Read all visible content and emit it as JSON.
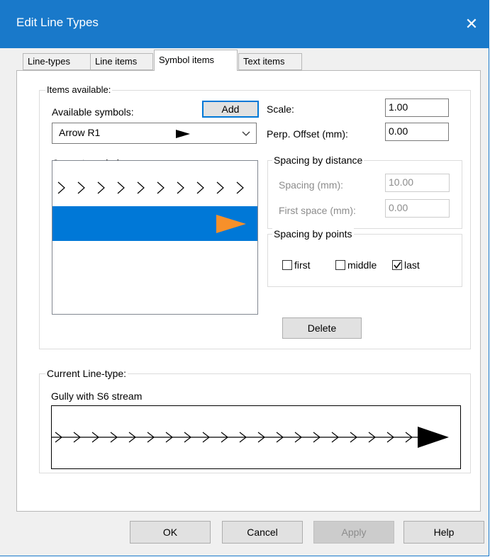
{
  "window": {
    "title": "Edit Line Types",
    "close_glyph": "✕"
  },
  "tabs": [
    {
      "label": "Line-types",
      "selected": false
    },
    {
      "label": "Line items",
      "selected": false
    },
    {
      "label": "Symbol items",
      "selected": true
    },
    {
      "label": "Text items",
      "selected": false
    }
  ],
  "items_available": {
    "legend": "Items available:",
    "available_symbols_label": "Available symbols:",
    "add_button": "Add",
    "selected_symbol": "Arrow R1",
    "current_symbols_label": "Current symbols:",
    "current_symbols": [
      {
        "icon": "chevron-series-icon",
        "selected": false
      },
      {
        "icon": "orange-arrow-icon",
        "selected": true,
        "color": "#f7902a"
      }
    ],
    "selection_color": "#0078d7",
    "scale_label": "Scale:",
    "scale_value": "1.00",
    "perp_offset_label": "Perp. Offset (mm):",
    "perp_offset_value": "0.00",
    "spacing_distance": {
      "legend": "Spacing by distance",
      "spacing_label": "Spacing (mm):",
      "spacing_value": "10.00",
      "first_space_label": "First space (mm):",
      "first_space_value": "0.00"
    },
    "spacing_points": {
      "legend": "Spacing by points",
      "first_label": "first",
      "first_checked": false,
      "middle_label": "middle",
      "middle_checked": false,
      "last_label": "last",
      "last_checked": true
    },
    "delete_button": "Delete"
  },
  "current_linetype": {
    "legend": "Current Line-type:",
    "name": "Gully with S6 stream"
  },
  "buttons": {
    "ok": "OK",
    "cancel": "Cancel",
    "apply": "Apply",
    "help": "Help"
  }
}
